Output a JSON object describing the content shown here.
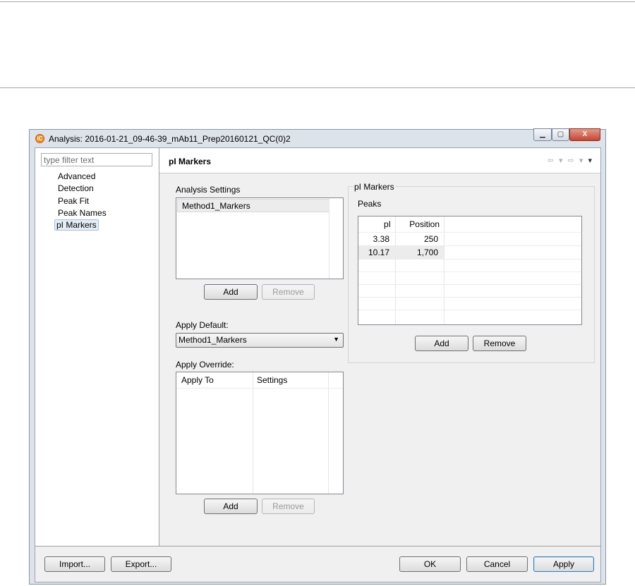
{
  "window": {
    "title": "Analysis: 2016-01-21_09-46-39_mAb11_Prep20160121_QC(0)2",
    "app_icon_glyph": "iC",
    "controls": {
      "minimize": "▁",
      "maximize": "▢",
      "close": "X"
    }
  },
  "sidebar": {
    "filter_placeholder": "type filter text",
    "items": [
      {
        "label": "Advanced"
      },
      {
        "label": "Detection"
      },
      {
        "label": "Peak Fit"
      },
      {
        "label": "Peak Names"
      },
      {
        "label": "pI Markers",
        "selected": true
      }
    ]
  },
  "page": {
    "title": "pI Markers",
    "nav_icons": [
      "back-arrow-icon",
      "forward-arrow-icon",
      "menu-dropdown-icon"
    ],
    "nav_glyphs": {
      "back": "⇦",
      "drop": "▾",
      "forward": "⇨",
      "menu": "▾"
    }
  },
  "analysis_settings": {
    "label": "Analysis Settings",
    "items": [
      "Method1_Markers"
    ],
    "add_label": "Add",
    "remove_label": "Remove"
  },
  "apply_default": {
    "label": "Apply Default:",
    "value": "Method1_Markers"
  },
  "apply_override": {
    "label": "Apply Override:",
    "columns": [
      "Apply To",
      "Settings"
    ],
    "add_label": "Add",
    "remove_label": "Remove"
  },
  "pi_markers_group": {
    "title": "pI Markers",
    "peaks_label": "Peaks",
    "columns": [
      "pI",
      "Position"
    ],
    "rows": [
      {
        "pi": "3.38",
        "position": "250"
      },
      {
        "pi": "10.17",
        "position": "1,700"
      }
    ],
    "add_label": "Add",
    "remove_label": "Remove"
  },
  "footer": {
    "import_label": "Import...",
    "export_label": "Export...",
    "ok_label": "OK",
    "cancel_label": "Cancel",
    "apply_label": "Apply"
  },
  "colors": {
    "window_frame": "#dde3ea",
    "dialog_bg": "#f0f0f0",
    "icon_orange": "#f08a1d",
    "close_red": "#c6452e"
  }
}
